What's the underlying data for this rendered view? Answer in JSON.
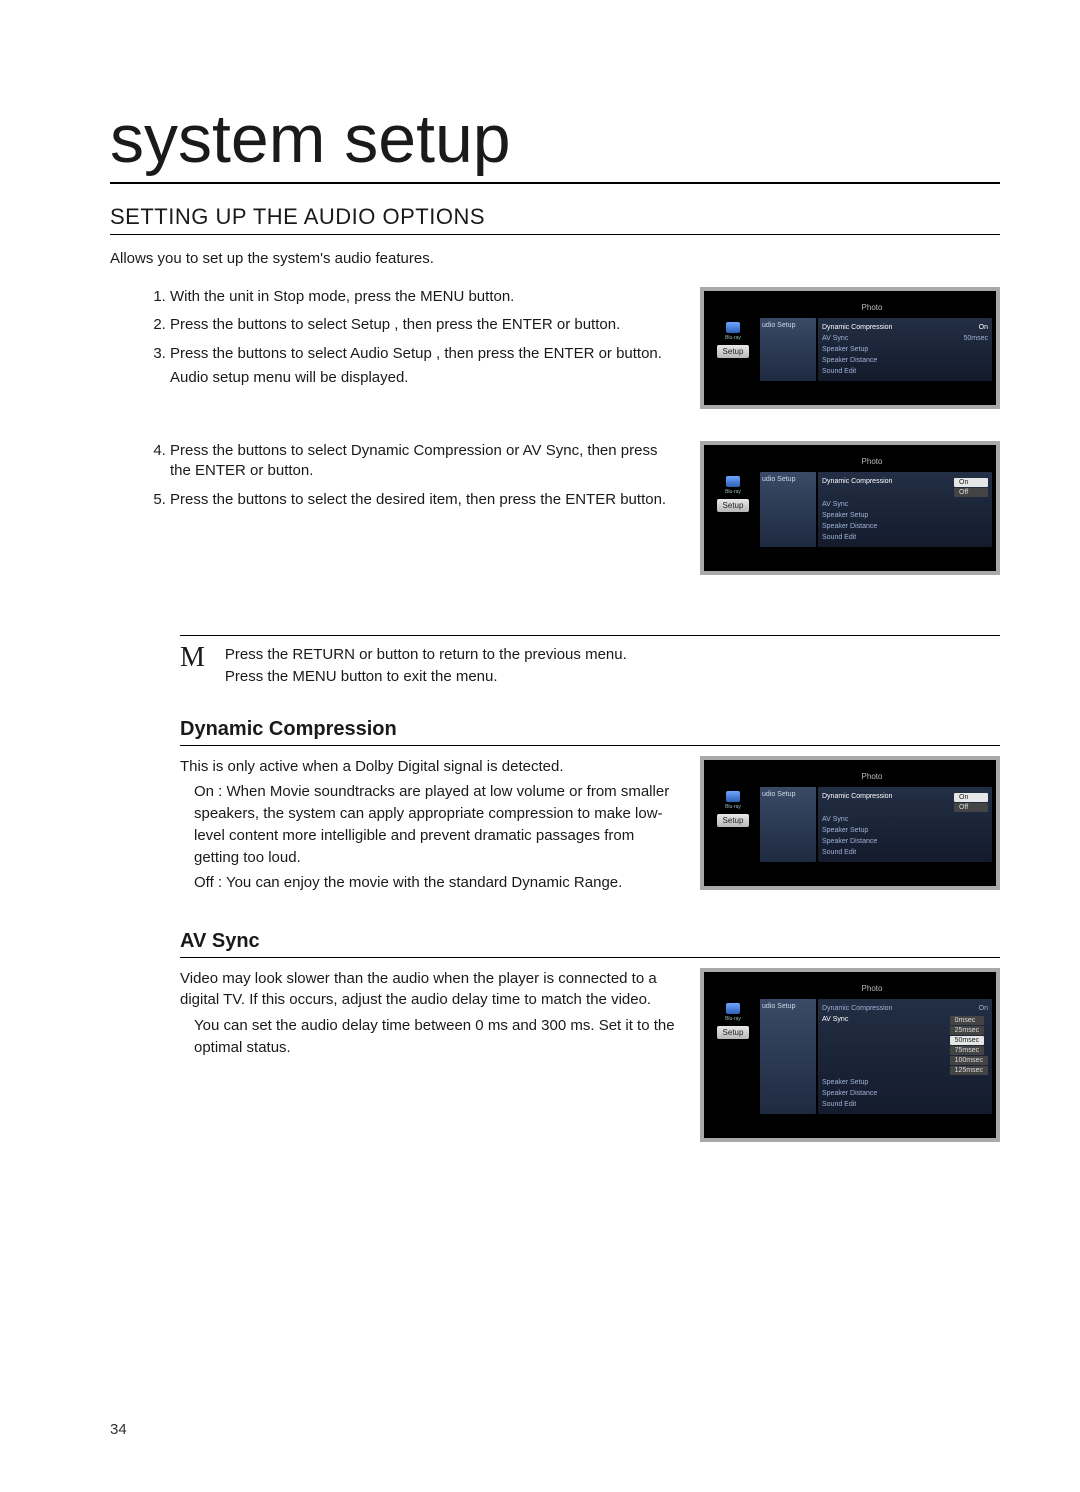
{
  "page_title": "system setup",
  "section_title": "SETTING UP THE AUDIO OPTIONS",
  "intro": "Allows you to set up the system's audio features.",
  "steps_a": [
    "With the unit in Stop mode, press the MENU button.",
    "Press the        buttons to select Setup , then press the ENTER or        button.",
    "Press the        buttons to select Audio Setup , then press the ENTER or        button."
  ],
  "step3_sub": "Audio setup menu will be displayed.",
  "steps_b": [
    "Press the        buttons to select Dynamic Compression  or AV Sync, then press the ENTER or        button.",
    "Press the        buttons to select the desired item, then press the ENTER button."
  ],
  "note": {
    "icon": "M",
    "line1": "Press the RETURN or        button to return to the previous menu.",
    "line2": "Press the MENU button to exit the menu."
  },
  "dc": {
    "heading": "Dynamic Compression",
    "intro": "This is only active when a Dolby Digital signal is detected.",
    "on": "On : When Movie soundtracks are played at low volume or from smaller speakers, the system can apply appropriate compression to make low-level content more intelligible and prevent dramatic passages from getting too loud.",
    "off": "Off : You can enjoy the movie with the standard Dynamic Range."
  },
  "av": {
    "heading": "AV Sync",
    "intro": "Video may look slower than the audio when the player is connected to a digital TV. If this occurs, adjust the audio delay time to match the video.",
    "bullet": "You can set the audio delay time between 0 ms and 300 ms. Set it to the optimal status."
  },
  "shot_labels": {
    "top": "Photo",
    "left_btn": "Setup",
    "mid_tab": "udio Setup",
    "rows": {
      "dc": "Dynamic Compression",
      "avsync": "AV Sync",
      "spk_setup": "Speaker Setup",
      "spk_dist": "Speaker Distance",
      "sound_edit": "Sound Edit"
    },
    "vals": {
      "on": "On",
      "off": "Off",
      "fiftyms": "50msec",
      "ms0": "0msec",
      "ms25": "25msec",
      "ms50": "50msec",
      "ms75": "75msec",
      "ms100": "100msec",
      "ms125": "125msec"
    }
  },
  "page_number": "34"
}
